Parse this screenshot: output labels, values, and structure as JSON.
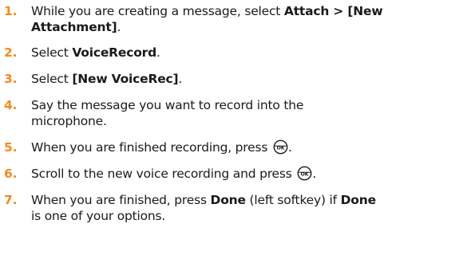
{
  "steps": [
    {
      "number": "1.",
      "text_a": "While you are creating a message, select ",
      "bold_a": "Attach > [New",
      "bold_b": "Attachment]",
      "text_b": "."
    },
    {
      "number": "2.",
      "text_a": "Select ",
      "bold_a": "VoiceRecord",
      "text_b": "."
    },
    {
      "number": "3.",
      "text_a": "Select ",
      "bold_a": "[New VoiceRec]",
      "text_b": "."
    },
    {
      "number": "4.",
      "line_a": "Say the message you want to record into the",
      "line_b": "microphone."
    },
    {
      "number": "5.",
      "text_a": "When you are finished recording, press ",
      "icon": "ok-key-icon",
      "text_b": "."
    },
    {
      "number": "6.",
      "text_a": "Scroll to the new voice recording and press ",
      "icon": "ok-key-icon",
      "text_b": "."
    },
    {
      "number": "7.",
      "text_a": "When you are finished, press ",
      "bold_a": "Done",
      "text_b": " (left softkey) if ",
      "bold_b": "Done",
      "text_c": "is one of your options."
    }
  ],
  "colors": {
    "step_number": "#f58a1f",
    "text": "#1a1a1a"
  }
}
